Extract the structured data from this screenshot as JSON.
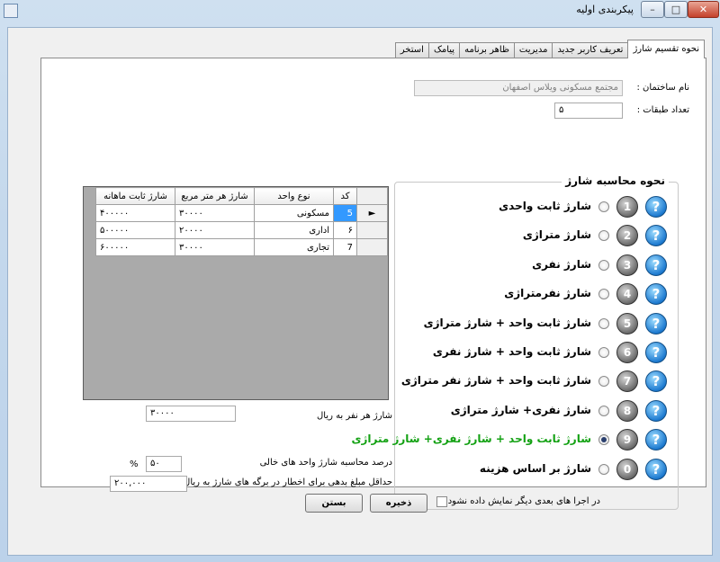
{
  "window": {
    "title": "پیکربندی اولیه",
    "min": "–",
    "max": "□",
    "close": "✕"
  },
  "tabs": [
    "نحوه تقسیم شارژ",
    "تعریف کاربر جدید",
    "مدیریت",
    "ظاهر برنامه",
    "پیامک",
    "استخر"
  ],
  "building": {
    "name_label": "نام ساختمان :",
    "name_value": "مجتمع مسکونی ویلاس اصفهان",
    "floors_label": "تعداد طبقات :",
    "floors_value": "۵"
  },
  "grid": {
    "headers": [
      "کد",
      "نوع واحد",
      "شارژ هر متر مربع",
      "شارژ ثابت ماهانه"
    ],
    "rows": [
      {
        "code": "5",
        "type": "مسکونی",
        "per_meter": "۳۰۰۰۰",
        "monthly": "۴۰۰۰۰۰"
      },
      {
        "code": "۶",
        "type": "اداری",
        "per_meter": "۲۰۰۰۰",
        "monthly": "۵۰۰۰۰۰"
      },
      {
        "code": "7",
        "type": "تجاری",
        "per_meter": "۳۰۰۰۰",
        "monthly": "۶۰۰۰۰۰"
      }
    ],
    "current_row_marker": "►"
  },
  "per_person": {
    "label": "شارژ هر نفر به ریال",
    "value": "۳۰۰۰۰"
  },
  "vacancy": {
    "label": "درصد محاسبه شارژ واحد های خالی",
    "value": "۵۰",
    "unit": "%"
  },
  "min_debt": {
    "label": "حداقل مبلغ بدهی برای اخطار در برگه های شارژ به ریال",
    "value": "۲۰۰,۰۰۰"
  },
  "charge_method": {
    "title": "نحوه محاسبه شارژ",
    "help_glyph": "?",
    "selected_index": 8,
    "options": [
      {
        "num": "1",
        "label": "شارژ ثابت واحدی"
      },
      {
        "num": "2",
        "label": "شارژ متراژی"
      },
      {
        "num": "3",
        "label": "شارژ نفری"
      },
      {
        "num": "4",
        "label": "شارژ نفرمتراژی"
      },
      {
        "num": "5",
        "label": "شارژ ثابت واحد + شارژ متراژی"
      },
      {
        "num": "6",
        "label": "شارژ ثابت واحد + شارژ نفری"
      },
      {
        "num": "7",
        "label": "شارژ ثابت واحد + شارژ نفر متراژی"
      },
      {
        "num": "8",
        "label": "شارژ نفری+ شارژ متراژی"
      },
      {
        "num": "9",
        "label": "شارژ ثابت واحد + شارژ نفری+ شارژ متراژی"
      },
      {
        "num": "0",
        "label": "شارژ بر اساس هزینه"
      }
    ]
  },
  "footer": {
    "dont_show_label": "در اجرا های بعدی دیگر نمایش داده نشود",
    "save_label": "ذخیره",
    "close_label": "بستن"
  },
  "colors": {
    "selected_option": "#13a113",
    "grid_selection": "#3399ff",
    "help_button": "#1d7ad0"
  }
}
